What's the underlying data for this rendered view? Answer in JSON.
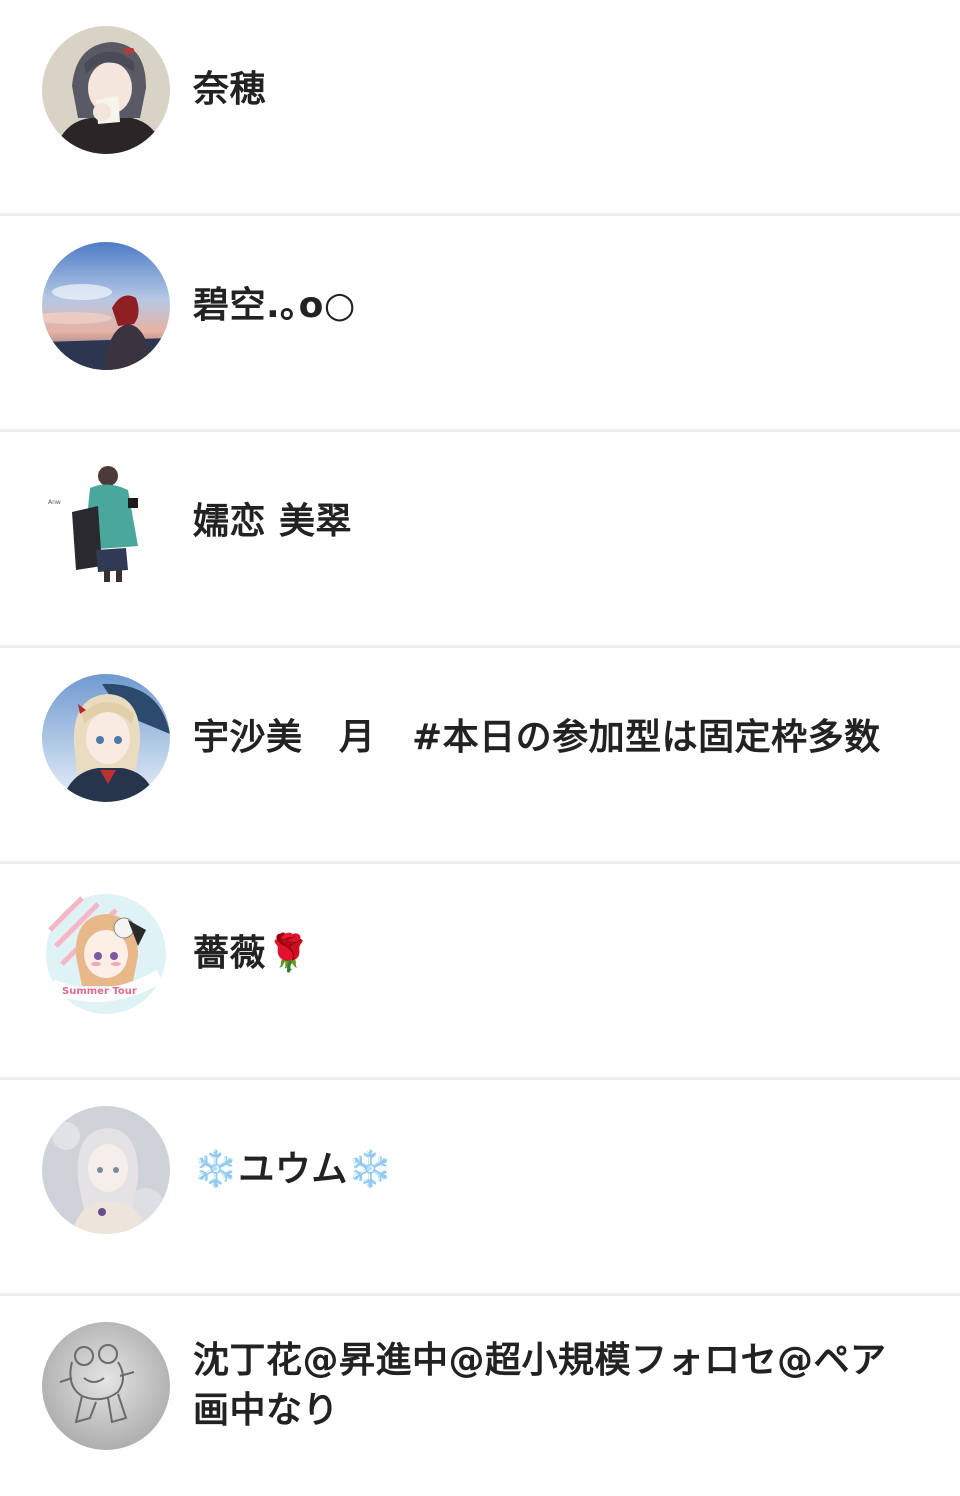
{
  "followers": [
    {
      "name": "奈穂",
      "avatar_icon": "avatar-girl-dark-hair-icon"
    },
    {
      "name": "碧空.｡o○",
      "avatar_icon": "avatar-sunset-sky-icon"
    },
    {
      "name": "嬬恋 美翠",
      "avatar_icon": "avatar-girl-backpack-icon"
    },
    {
      "name": "宇沙美　月　#本日の参加型は固定枠多数",
      "avatar_icon": "avatar-blonde-girl-umbrella-icon"
    },
    {
      "name": "薔薇🌹",
      "avatar_icon": "avatar-summer-tour-badge-icon"
    },
    {
      "name": "❄️ユウム❄️",
      "avatar_icon": "avatar-silver-hair-girl-icon"
    },
    {
      "name": "沈丁花@昇進中@超小規模フォロセ@ペア画中なり",
      "avatar_icon": "avatar-frog-sketch-icon"
    }
  ],
  "colors": {
    "divider": "#ececec",
    "text": "#222222",
    "background": "#ffffff"
  }
}
